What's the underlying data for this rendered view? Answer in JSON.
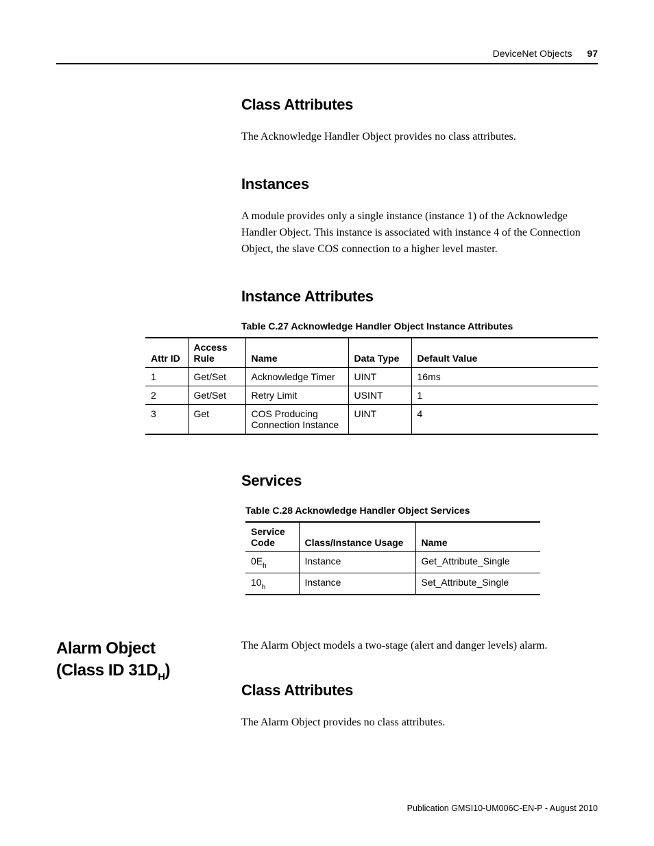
{
  "header": {
    "section": "DeviceNet Objects",
    "page_number": "97"
  },
  "sections": {
    "class_attributes_1": {
      "heading": "Class Attributes",
      "body": "The Acknowledge Handler Object provides no class attributes."
    },
    "instances": {
      "heading": "Instances",
      "body": "A module provides only a single instance (instance 1) of the Acknowledge Handler Object. This instance is associated with instance 4 of the Connection Object, the slave COS connection to a higher level master."
    },
    "instance_attributes": {
      "heading": "Instance Attributes"
    },
    "services": {
      "heading": "Services"
    },
    "alarm_intro": {
      "body": "The Alarm Object models a two-stage (alert and danger levels) alarm."
    },
    "class_attributes_2": {
      "heading": "Class Attributes",
      "body": "The Alarm Object provides no class attributes."
    }
  },
  "side_heading": {
    "line1": "Alarm Object",
    "line2_pre": "(Class ID 31D",
    "line2_sub": "H",
    "line2_post": ")"
  },
  "table_c27": {
    "caption": "Table C.27 Acknowledge Handler Object Instance Attributes",
    "headers": [
      "Attr ID",
      "Access Rule",
      "Name",
      "Data Type",
      "Default Value"
    ],
    "rows": [
      [
        "1",
        "Get/Set",
        "Acknowledge Timer",
        "UINT",
        "16ms"
      ],
      [
        "2",
        "Get/Set",
        "Retry Limit",
        "USINT",
        "1"
      ],
      [
        "3",
        "Get",
        "COS Producing Connection Instance",
        "UINT",
        "4"
      ]
    ]
  },
  "table_c28": {
    "caption": "Table C.28 Acknowledge Handler Object Services",
    "headers": [
      "Service Code",
      "Class/Instance Usage",
      "Name"
    ],
    "rows": [
      {
        "code_main": "0E",
        "code_sub": "h",
        "usage": "Instance",
        "name": "Get_Attribute_Single"
      },
      {
        "code_main": "10",
        "code_sub": "h",
        "usage": "Instance",
        "name": "Set_Attribute_Single"
      }
    ]
  },
  "footer": {
    "publication": "Publication GMSI10-UM006C-EN-P - August 2010"
  }
}
